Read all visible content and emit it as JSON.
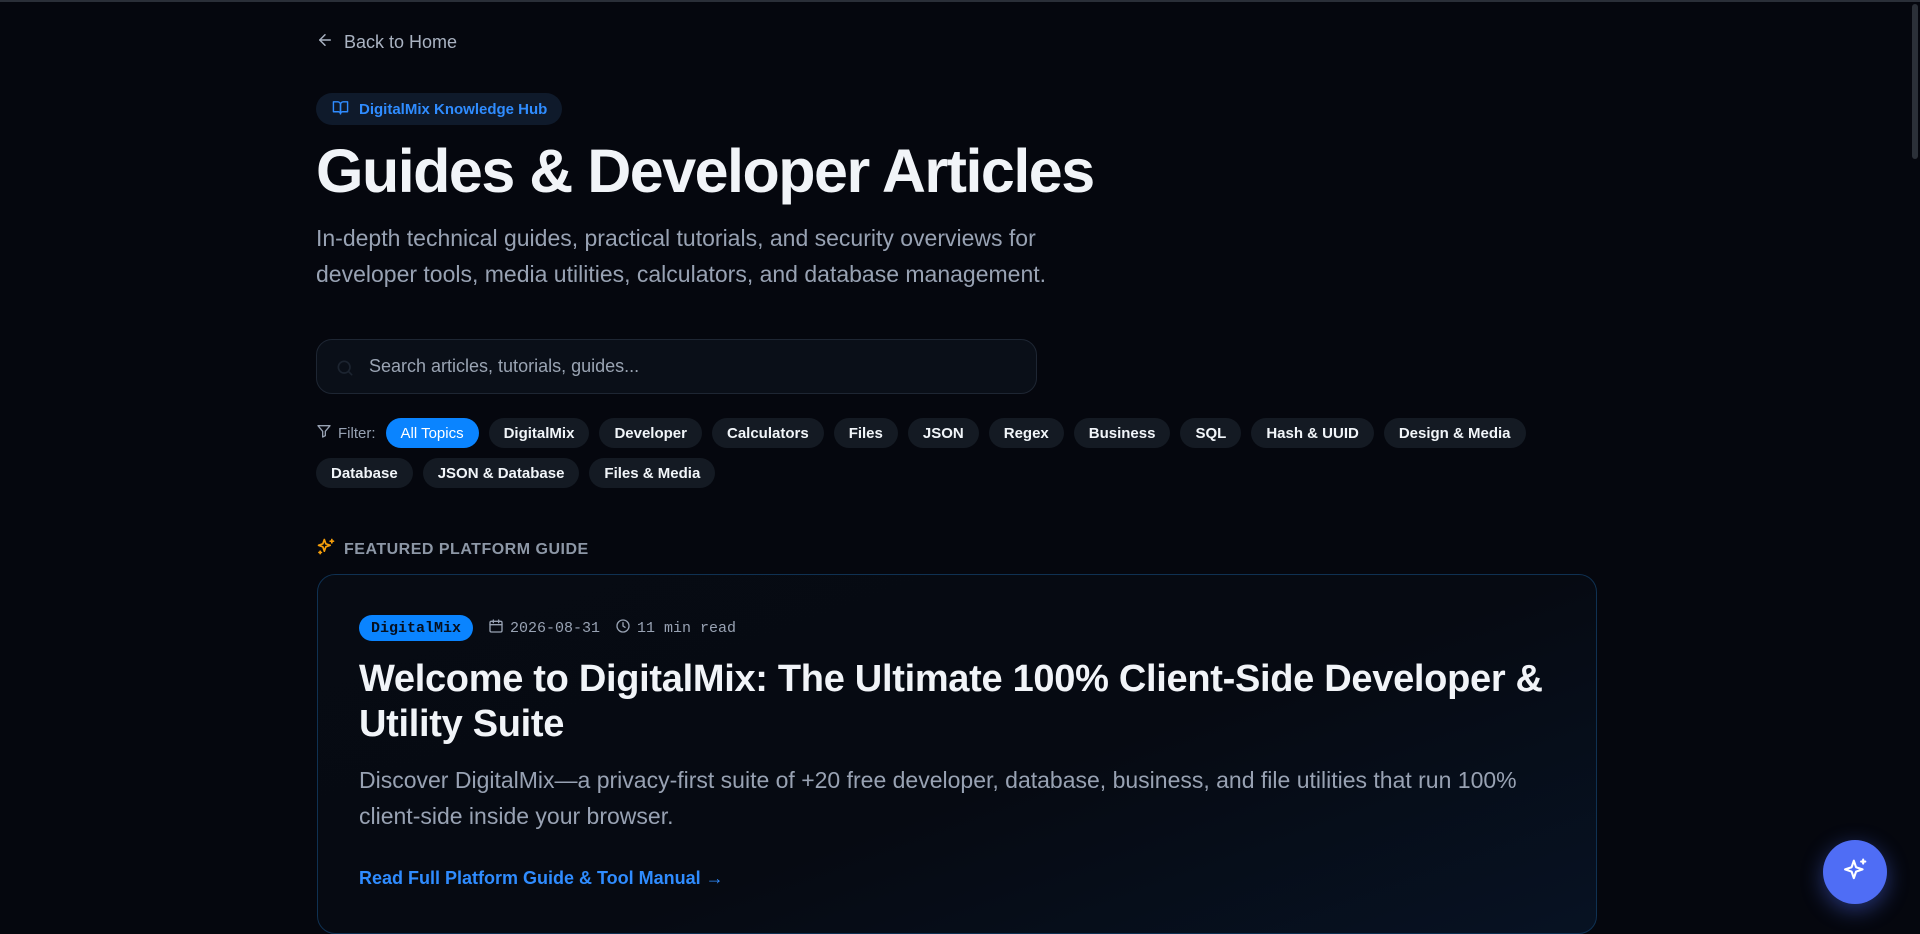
{
  "nav": {
    "back_label": "Back to Home"
  },
  "hero": {
    "badge": "DigitalMix Knowledge Hub",
    "title": "Guides & Developer Articles",
    "subtitle": "In-depth technical guides, practical tutorials, and security overviews for developer tools, media utilities, calculators, and database management."
  },
  "search": {
    "placeholder": "Search articles, tutorials, guides..."
  },
  "filters": {
    "label": "Filter:",
    "active": "All Topics",
    "chips": [
      "All Topics",
      "DigitalMix",
      "Developer",
      "Calculators",
      "Files",
      "JSON",
      "Regex",
      "Business",
      "SQL",
      "Hash & UUID",
      "Design & Media",
      "Database",
      "JSON & Database",
      "Files & Media"
    ]
  },
  "featured": {
    "heading": "FEATURED PLATFORM GUIDE",
    "tag": "DigitalMix",
    "date": "2026-08-31",
    "read_time": "11 min read",
    "title": "Welcome to DigitalMix: The Ultimate 100% Client-Side Developer & Utility Suite",
    "description": "Discover DigitalMix—a privacy-first suite of +20 free developer, database, business, and file utilities that run 100% client-side inside your browser.",
    "link_label": "Read Full Platform Guide & Tool Manual →"
  },
  "icons": {
    "back": "arrow-left-icon",
    "badge": "book-open-icon",
    "search": "search-icon",
    "filter": "funnel-icon",
    "featured": "sparkles-icon",
    "date": "calendar-icon",
    "time": "clock-icon",
    "fab": "sparkle-icon"
  },
  "colors": {
    "background": "#05070e",
    "accent": "#0a84ff",
    "link": "#2f8cff",
    "featured_icon": "#f59e0b",
    "fab": "#4f6df5"
  }
}
